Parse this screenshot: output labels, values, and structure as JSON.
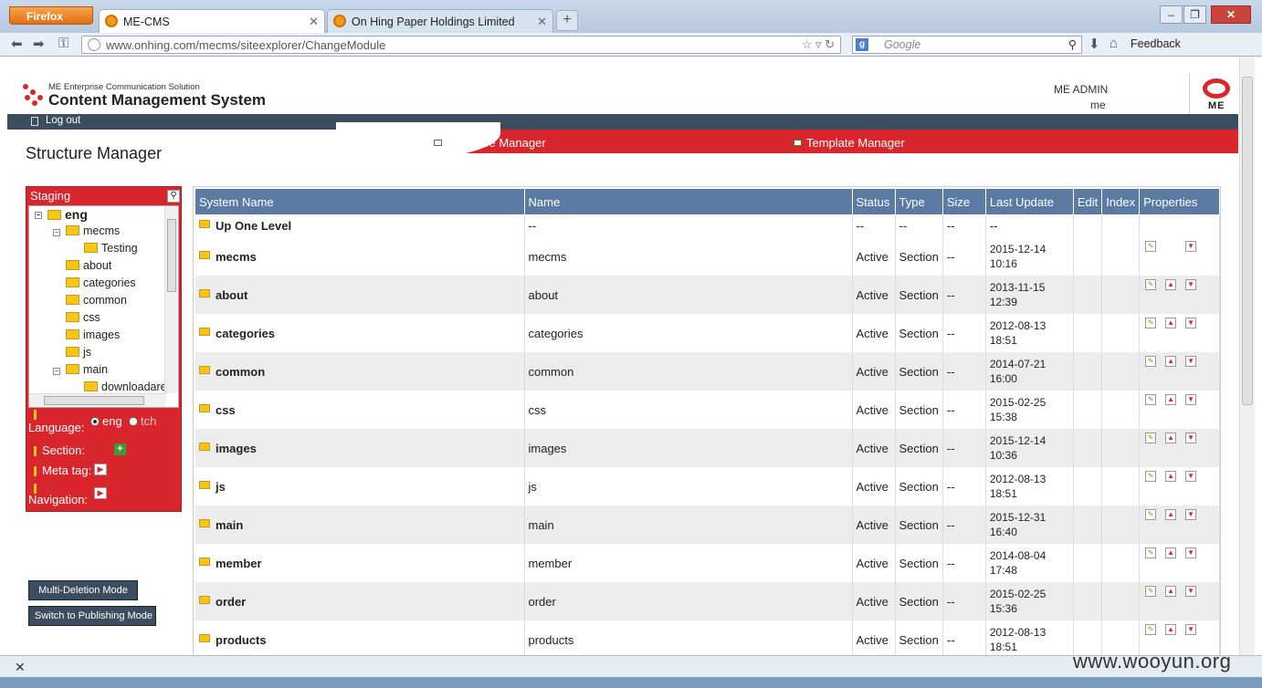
{
  "browser": {
    "menu_label": "Firefox",
    "tabs": [
      {
        "title": "ME-CMS"
      },
      {
        "title": "On Hing Paper Holdings Limited"
      }
    ],
    "new_tab": "+",
    "url": "www.onhing.com/mecms/siteexplorer/ChangeModule",
    "search_placeholder": "Google",
    "feedback_label": "Feedback"
  },
  "header": {
    "logo_subtitle": "ME Enterprise Communication Solution",
    "logo_title": "Content Management System",
    "admin_name": "ME ADMIN",
    "admin_user": "me",
    "brand": "ME"
  },
  "logout_label": "Log out",
  "nav": {
    "structure_manager": "Structure Manager",
    "template_manager": "Template Manager"
  },
  "page_title": "Structure Manager",
  "staging": {
    "title": "Staging",
    "tree": [
      {
        "label": "eng"
      },
      {
        "label": "mecms"
      },
      {
        "label": "Testing"
      },
      {
        "label": "about"
      },
      {
        "label": "categories"
      },
      {
        "label": "common"
      },
      {
        "label": "css"
      },
      {
        "label": "images"
      },
      {
        "label": "js"
      },
      {
        "label": "main"
      },
      {
        "label": "downloadare"
      }
    ],
    "language_label": "Language:",
    "lang_eng": "eng",
    "lang_tch": "tch",
    "section_label": "Section:",
    "metatag_label": "Meta tag:",
    "navigation_label": "Navigation:"
  },
  "buttons": {
    "multi_deletion": "Multi-Deletion Mode",
    "switch_publishing": "Switch to Publishing Mode"
  },
  "table": {
    "headers": [
      "System Name",
      "Name",
      "Status",
      "Type",
      "Size",
      "Last Update",
      "Edit",
      "Index",
      "Properties"
    ],
    "up_row": {
      "system": "Up One Level",
      "name": "--",
      "status": "--",
      "type": "--",
      "size": "--",
      "update": "--"
    },
    "rows": [
      {
        "system": "mecms",
        "name": "mecms",
        "status": "Active",
        "type": "Section",
        "size": "--",
        "date": "2015-12-14",
        "time": "10:16"
      },
      {
        "system": "about",
        "name": "about",
        "status": "Active",
        "type": "Section",
        "size": "--",
        "date": "2013-11-15",
        "time": "12:39"
      },
      {
        "system": "categories",
        "name": "categories",
        "status": "Active",
        "type": "Section",
        "size": "--",
        "date": "2012-08-13",
        "time": "18:51"
      },
      {
        "system": "common",
        "name": "common",
        "status": "Active",
        "type": "Section",
        "size": "--",
        "date": "2014-07-21",
        "time": "16:00"
      },
      {
        "system": "css",
        "name": "css",
        "status": "Active",
        "type": "Section",
        "size": "--",
        "date": "2015-02-25",
        "time": "15:38"
      },
      {
        "system": "images",
        "name": "images",
        "status": "Active",
        "type": "Section",
        "size": "--",
        "date": "2015-12-14",
        "time": "10:36"
      },
      {
        "system": "js",
        "name": "js",
        "status": "Active",
        "type": "Section",
        "size": "--",
        "date": "2012-08-13",
        "time": "18:51"
      },
      {
        "system": "main",
        "name": "main",
        "status": "Active",
        "type": "Section",
        "size": "--",
        "date": "2015-12-31",
        "time": "16:40"
      },
      {
        "system": "member",
        "name": "member",
        "status": "Active",
        "type": "Section",
        "size": "--",
        "date": "2014-08-04",
        "time": "17:48"
      },
      {
        "system": "order",
        "name": "order",
        "status": "Active",
        "type": "Section",
        "size": "--",
        "date": "2015-02-25",
        "time": "15:36"
      },
      {
        "system": "products",
        "name": "products",
        "status": "Active",
        "type": "Section",
        "size": "--",
        "date": "2012-08-13",
        "time": "18:51"
      }
    ]
  },
  "watermark": "www.wooyun.org"
}
